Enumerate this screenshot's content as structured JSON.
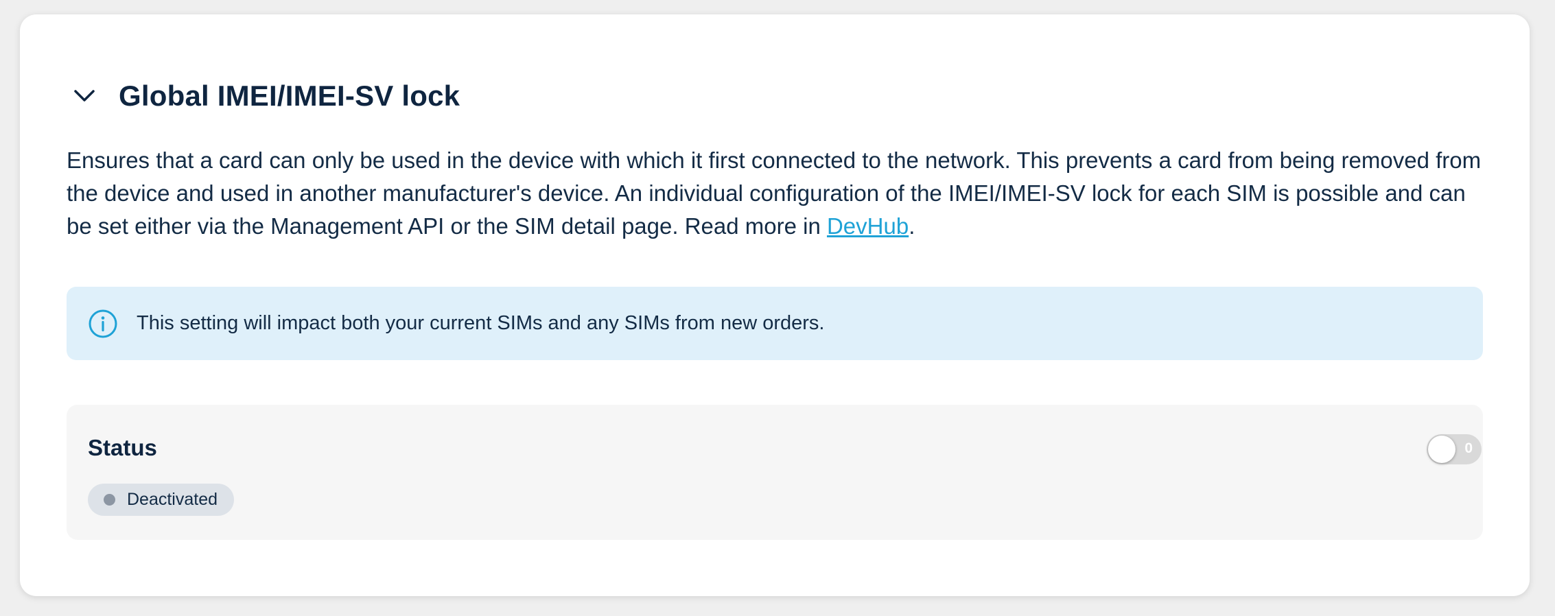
{
  "section": {
    "title": "Global IMEI/IMEI-SV lock",
    "collapse_icon": "chevron-down-icon",
    "description_main": "Ensures that a card can only be used in the device with which it first connected to the network. This prevents a card from being removed from the device and used in another manufacturer's device. An individual configuration of the IMEI/IMEI-SV lock for each SIM is possible and can be set either via the Management API or the SIM detail page. Read more in ",
    "description_link": "DevHub",
    "description_end": "."
  },
  "info": {
    "icon": "info-icon",
    "text": "This setting will impact both your current SIMs and any SIMs from new orders.",
    "background": "#dff0fa",
    "accent": "#1ea2d6"
  },
  "status": {
    "label": "Status",
    "badge_text": "Deactivated",
    "toggle_text": "0",
    "toggle_on": false
  },
  "colors": {
    "text": "#102a43",
    "link": "#1ea2d6"
  }
}
